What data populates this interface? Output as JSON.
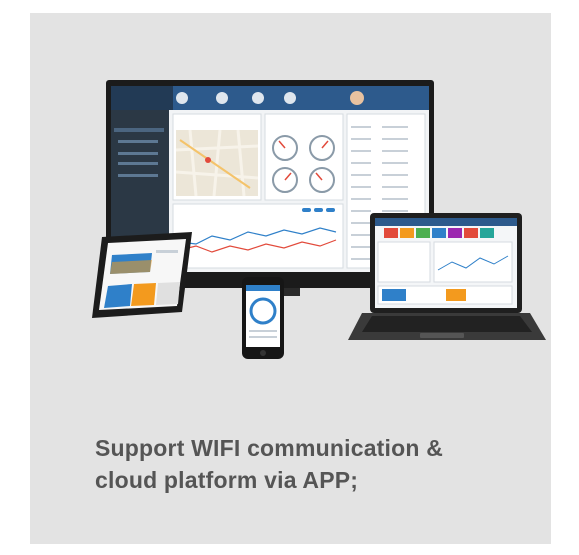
{
  "caption": {
    "line1": "Support WIFI communication &",
    "line2": "cloud platform via APP;"
  },
  "colors": {
    "panel_bg": "#e3e3e3",
    "caption_text": "#555555",
    "monitor_frame": "#1b1b1b",
    "dashboard_sidebar": "#2b3845",
    "dashboard_header": "#2d5a8c",
    "accent_blue": "#2f80c9",
    "accent_orange": "#f39a1e"
  },
  "icons": [
    "monitor-image",
    "tablet-image",
    "phone-image",
    "laptop-image"
  ]
}
